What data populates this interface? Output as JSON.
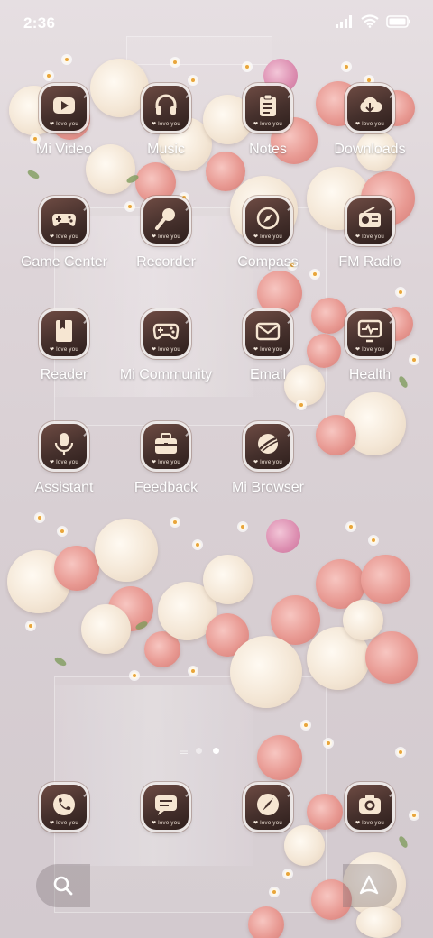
{
  "status_bar": {
    "time": "2:36"
  },
  "apps": [
    {
      "label": "Mi Video",
      "icon": "video-icon",
      "tag": "❤ love you"
    },
    {
      "label": "Music",
      "icon": "headphones-icon",
      "tag": "❤ love you"
    },
    {
      "label": "Notes",
      "icon": "clipboard-icon",
      "tag": "❤ love you"
    },
    {
      "label": "Downloads",
      "icon": "cloud-download-icon",
      "tag": "❤ love you"
    },
    {
      "label": "Game Center",
      "icon": "gamepad-icon",
      "tag": "❤ love you"
    },
    {
      "label": "Recorder",
      "icon": "microphone-icon",
      "tag": "❤ love you"
    },
    {
      "label": "Compass",
      "icon": "compass-icon",
      "tag": "❤ love you"
    },
    {
      "label": "FM Radio",
      "icon": "radio-icon",
      "tag": "❤ love you"
    },
    {
      "label": "Reader",
      "icon": "book-icon",
      "tag": "❤ love you"
    },
    {
      "label": "Mi Community",
      "icon": "controller-icon",
      "tag": "❤ love you"
    },
    {
      "label": "Email",
      "icon": "envelope-icon",
      "tag": "❤ love you"
    },
    {
      "label": "Health",
      "icon": "heart-monitor-icon",
      "tag": "❤ love you"
    },
    {
      "label": "Assistant",
      "icon": "voice-assistant-icon",
      "tag": "❤ love you"
    },
    {
      "label": "Feedback",
      "icon": "briefcase-icon",
      "tag": "❤ love you"
    },
    {
      "label": "Mi Browser",
      "icon": "globe-icon",
      "tag": "❤ love you"
    }
  ],
  "dock": [
    {
      "icon": "phone-icon",
      "tag": "❤ love you"
    },
    {
      "icon": "messages-icon",
      "tag": "❤ love you"
    },
    {
      "icon": "browser-compass-icon",
      "tag": "❤ love you"
    },
    {
      "icon": "camera-icon",
      "tag": "❤ love you"
    }
  ],
  "page_indicator": {
    "pages": 2,
    "current": 2
  },
  "colors": {
    "icon_bg": "#45302c",
    "glyph": "#f6e6d2",
    "label": "#ffffff"
  }
}
